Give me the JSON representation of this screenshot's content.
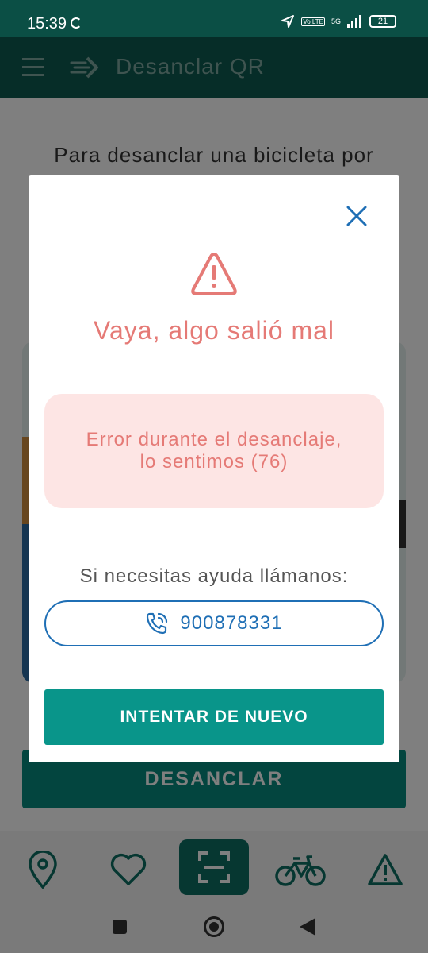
{
  "status_bar": {
    "time": "15:39",
    "volte": "Vo LTE",
    "network": "5G",
    "battery": "21"
  },
  "app_bar": {
    "title": "Desanclar QR",
    "menu_icon": "menu-icon",
    "logo_icon": "bike-sharing-logo-icon"
  },
  "page": {
    "instruction_text": "Para desanclar una bicicleta por",
    "desanclar_button": "DESANCLAR"
  },
  "modal": {
    "title": "Vaya, algo salió mal",
    "error_message": "Error durante el desanclaje, lo sentimos (76)",
    "help_text": "Si necesitas ayuda llámanos:",
    "phone_number": "900878331",
    "retry_button": "INTENTAR DE NUEVO",
    "colors": {
      "error": "#e57a76",
      "error_bg": "#fde5e4",
      "phone": "#1f6fb5",
      "primary": "#09958a"
    }
  },
  "bottom_nav": {
    "items": [
      {
        "icon": "location-pin-icon"
      },
      {
        "icon": "heart-icon"
      },
      {
        "icon": "qr-scan-icon",
        "active": true
      },
      {
        "icon": "bicycle-icon"
      },
      {
        "icon": "warning-icon"
      }
    ]
  }
}
